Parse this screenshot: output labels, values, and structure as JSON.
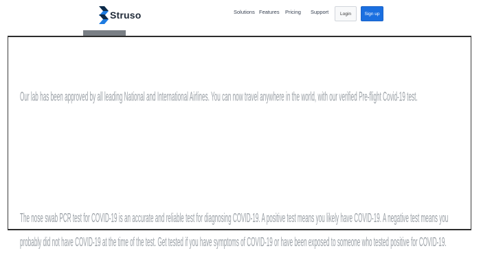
{
  "brand": {
    "name": "Struso",
    "logo_icon": "struso-chevron-logo",
    "logo_colors": [
      "#0b2a4a",
      "#1e7be0"
    ]
  },
  "nav": {
    "links": [
      "Solutions",
      "Features",
      "Pricing",
      "Support"
    ],
    "login_label": "Login",
    "signup_label": "Sign up",
    "signup_color": "#1a6fe0"
  },
  "content": {
    "paragraph_1": "Our lab has been approved by all leading National and International Airlines. You can now travel anywhere in the world, with our verified Pre-flight Covid-19 test.",
    "paragraph_2": "The nose swab PCR test for COVID-19 is an accurate and reliable test for diagnosing COVID-19. A positive test means you likely have COVID-19. A negative test means you probably did not have COVID-19 at the time of the test. Get tested if you have symptoms of COVID-19 or have been exposed to someone who tested positive for COVID-19."
  }
}
